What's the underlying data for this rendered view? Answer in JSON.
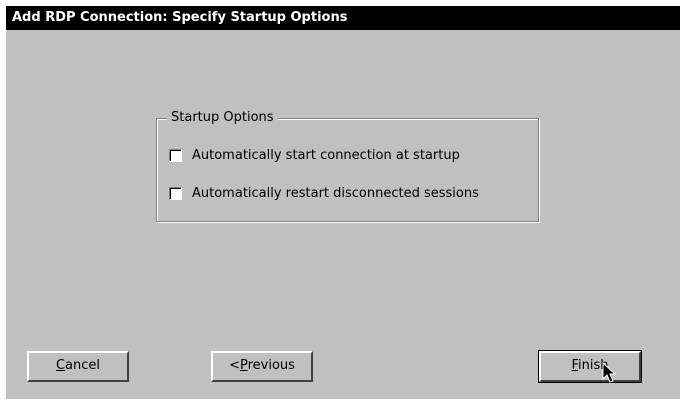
{
  "window": {
    "title": "Add RDP Connection: Specify Startup Options"
  },
  "startup_options": {
    "legend": "Startup Options",
    "options": [
      {
        "label": "Automatically start connection at startup",
        "checked": false
      },
      {
        "label": "Automatically restart disconnected sessions",
        "checked": false
      }
    ]
  },
  "buttons": {
    "cancel": {
      "mnemonic": "C",
      "rest": "ancel"
    },
    "previous": {
      "prefix": "<",
      "mnemonic": "P",
      "rest": "revious"
    },
    "finish": {
      "mnemonic": "F",
      "rest": "inish"
    }
  },
  "icons": {
    "cursor": "mouse-pointer-icon"
  }
}
